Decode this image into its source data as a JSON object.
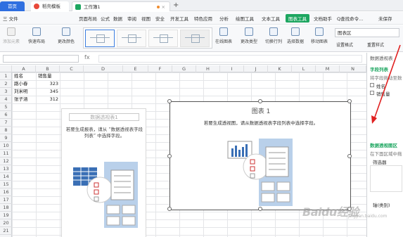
{
  "tabs": {
    "home": "首页",
    "docer": "稻壳模板",
    "workbook": "工作簿1",
    "new_tab": "+"
  },
  "menu": {
    "file": "三 文件",
    "items": [
      "页面布局",
      "公式",
      "数据",
      "审阅",
      "视图",
      "安全",
      "开发工具",
      "特色应用",
      "分析",
      "绘图工具",
      "文本工具"
    ],
    "chart_tools": "图表工具",
    "doc_helper": "文档助手",
    "search": "Q查找命令...",
    "collab": "未保存"
  },
  "ribbon": {
    "add_element": "添加元素",
    "quick_layout": "快速布局",
    "change_color": "更改颜色",
    "online_chart": "在线图表",
    "change_type": "更改类型",
    "switch_rowcol": "切换行列",
    "select_data": "选择数据",
    "move_chart": "移动图表",
    "chart_area": "图表区",
    "set_format": "设置格式",
    "reset_style": "重置样式"
  },
  "formula": {
    "fx": "fx"
  },
  "columns": [
    "A",
    "B",
    "C",
    "D",
    "E",
    "F",
    "G",
    "H",
    "I",
    "J",
    "K",
    "L",
    "M",
    "N"
  ],
  "rows": [
    "1",
    "2",
    "3",
    "4",
    "5",
    "6",
    "7",
    "8",
    "9",
    "10",
    "11",
    "12",
    "13",
    "14",
    "15",
    "16",
    "17",
    "18",
    "19",
    "20",
    "21"
  ],
  "table": {
    "header": [
      "姓名",
      "销售量"
    ],
    "data": [
      [
        "路小春",
        "323"
      ],
      [
        "刘米明",
        "345"
      ],
      [
        "张子涵",
        "312"
      ]
    ]
  },
  "pivot": {
    "title": "数据透视表1",
    "hint": "若要生成报表，请从 “数据透视表字段列表” 中选择字段。"
  },
  "chart": {
    "title": "图表 1",
    "hint": "若要生成透视图，请从数据透视表字段列表中选择字段。"
  },
  "panel": {
    "header": "数据透视表",
    "field_list": "字段列表",
    "field_hint": "将字段拖动至数",
    "fields": [
      "姓名",
      "销售量"
    ],
    "area_title": "数据透视图区",
    "area_hint": "在下面区域中拖",
    "filter": "筛选器",
    "axis": "轴(类别)"
  },
  "watermark": {
    "main": "Baidu经验",
    "sub": "jingyan.baidu.com"
  }
}
